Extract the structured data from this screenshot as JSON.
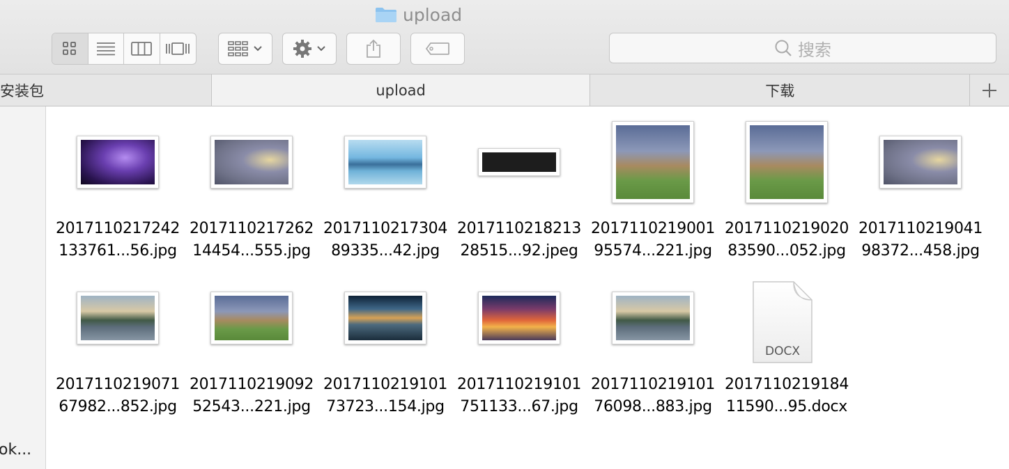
{
  "window": {
    "title": "upload"
  },
  "toolbar": {
    "view_modes": [
      "icon-view",
      "list-view",
      "column-view",
      "cover-flow-view"
    ],
    "active_view": "icon-view",
    "search_placeholder": "搜索"
  },
  "tabs": [
    {
      "label": "安装包"
    },
    {
      "label": "upload"
    },
    {
      "label": "下载"
    }
  ],
  "sidebar": {
    "items": [
      {
        "label": "ok..."
      }
    ]
  },
  "files": [
    {
      "line1": "2017110217242",
      "line2": "133761...56.jpg",
      "thumb": "lightning"
    },
    {
      "line1": "2017110217262",
      "line2": "14454...555.jpg",
      "thumb": "butterfly"
    },
    {
      "line1": "2017110217304",
      "line2": "89335...42.jpg",
      "thumb": "bridge"
    },
    {
      "line1": "2017110218213",
      "line2": "28515...92.jpeg",
      "thumb": "code"
    },
    {
      "line1": "2017110219001",
      "line2": "95574...221.jpg",
      "thumb": "eagle"
    },
    {
      "line1": "2017110219020",
      "line2": "83590...052.jpg",
      "thumb": "eagle"
    },
    {
      "line1": "2017110219041",
      "line2": "98372...458.jpg",
      "thumb": "butterfly"
    },
    {
      "line1": "2017110219071",
      "line2": "67982...852.jpg",
      "thumb": "lake"
    },
    {
      "line1": "2017110219092",
      "line2": "52543...221.jpg",
      "thumb": "eagle"
    },
    {
      "line1": "2017110219101",
      "line2": "73723...154.jpg",
      "thumb": "pier"
    },
    {
      "line1": "2017110219101",
      "line2": "751133...67.jpg",
      "thumb": "sunset"
    },
    {
      "line1": "2017110219101",
      "line2": "76098...883.jpg",
      "thumb": "lake"
    },
    {
      "line1": "2017110219184",
      "line2": "11590...95.docx",
      "thumb": "docx",
      "doc_badge": "DOCX"
    }
  ]
}
